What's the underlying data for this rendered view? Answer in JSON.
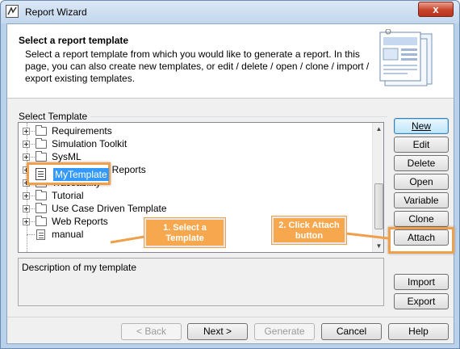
{
  "window": {
    "title": "Report Wizard",
    "close_glyph": "x"
  },
  "header": {
    "title": "Select a report template",
    "description": "Select a report template from which you would like to generate a report. In this page, you can also create new templates, or edit / delete / open / clone / import / export existing templates."
  },
  "group_label": "Select Template",
  "tree": {
    "items": [
      {
        "label": "Requirements",
        "type": "folder"
      },
      {
        "label": "Simulation Toolkit",
        "type": "folder"
      },
      {
        "label": "SysML",
        "type": "folder"
      },
      {
        "label": "SysML - Web Reports",
        "type": "folder"
      },
      {
        "label": "Traceability",
        "type": "folder"
      },
      {
        "label": "Tutorial",
        "type": "folder"
      },
      {
        "label": "Use Case Driven Template",
        "type": "folder"
      },
      {
        "label": "Web Reports",
        "type": "folder"
      },
      {
        "label": "manual",
        "type": "document"
      }
    ],
    "selected": {
      "label": "MyTemplate",
      "type": "document"
    }
  },
  "description_text": "Description of my template",
  "side_buttons": {
    "new": "New",
    "edit": "Edit",
    "delete": "Delete",
    "open": "Open",
    "variable": "Variable",
    "clone": "Clone",
    "attach": "Attach",
    "import": "Import",
    "export": "Export"
  },
  "callouts": {
    "select_template": "1. Select a Template",
    "click_attach": "2. Click Attach button"
  },
  "footer_buttons": {
    "back": "< Back",
    "next": "Next >",
    "generate": "Generate",
    "cancel": "Cancel",
    "help": "Help"
  },
  "colors": {
    "callout": "#f7a84f",
    "highlight_border": "#f0a04b",
    "selection": "#3399ff"
  }
}
